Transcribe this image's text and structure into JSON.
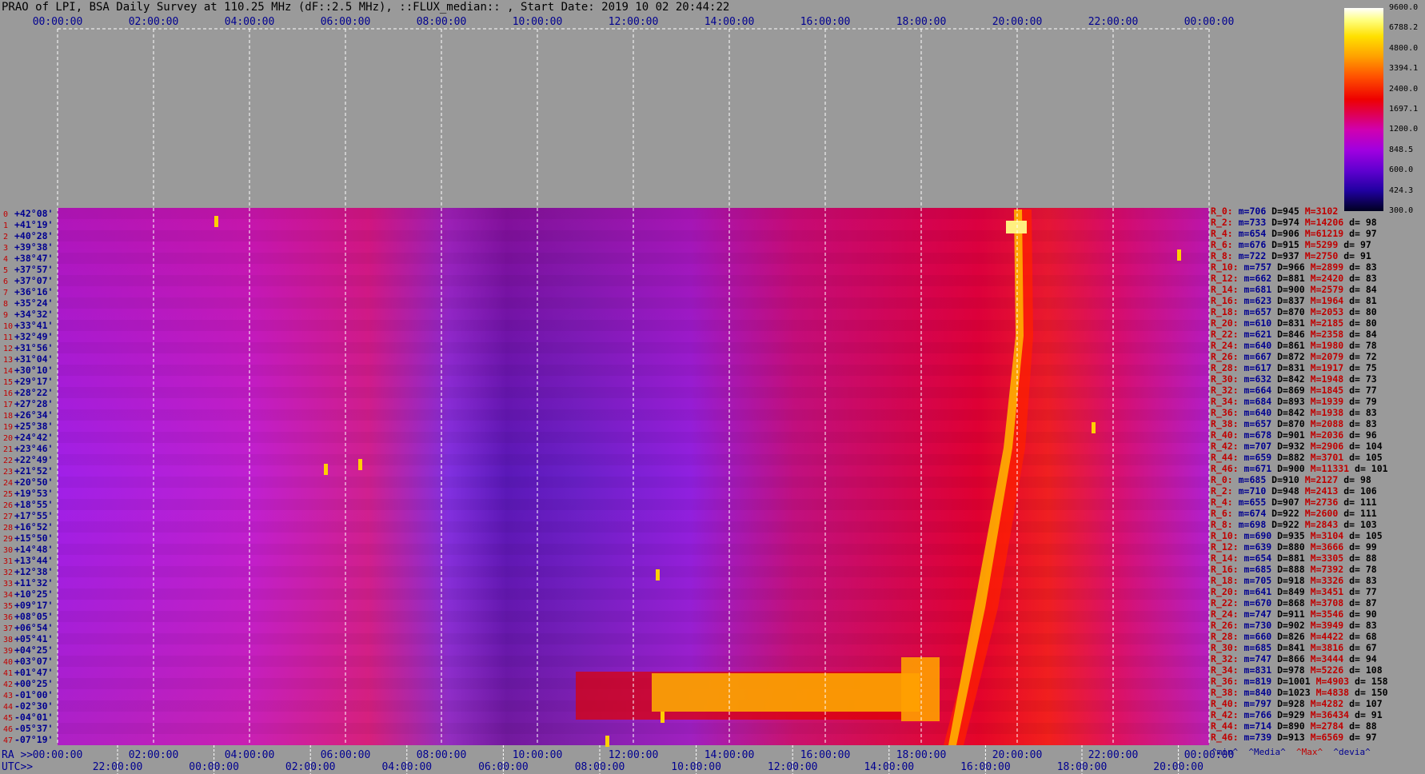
{
  "title": "PRAO of LPI, BSA Daily Survey at 110.25 MHz (dF::2.5 MHz), ::FLUX_median:: , Start Date: 2019 10 02 20:44:22",
  "colors": {
    "bg": "#9a9a9a",
    "label_red": "#c00000",
    "label_blue": "#000090"
  },
  "chart_data": {
    "type": "heatmap",
    "title": "PRAO of LPI, BSA Daily Survey at 110.25 MHz (dF::2.5 MHz), ::FLUX_median:: , Start Date: 2019 10 02 20:44:22",
    "top_axis_ticks": [
      "00:00:00",
      "02:00:00",
      "04:00:00",
      "06:00:00",
      "08:00:00",
      "10:00:00",
      "12:00:00",
      "14:00:00",
      "16:00:00",
      "18:00:00",
      "20:00:00",
      "22:00:00",
      "00:00:00"
    ],
    "ra_axis_ticks": [
      "00:00:00",
      "02:00:00",
      "04:00:00",
      "06:00:00",
      "08:00:00",
      "10:00:00",
      "12:00:00",
      "14:00:00",
      "16:00:00",
      "18:00:00",
      "20:00:00",
      "22:00:00",
      "00:00:00"
    ],
    "ra_axis_label": "RA >>",
    "utc_axis_ticks": [
      "22:00:00",
      "00:00:00",
      "02:00:00",
      "04:00:00",
      "06:00:00",
      "08:00:00",
      "10:00:00",
      "12:00:00",
      "14:00:00",
      "16:00:00",
      "18:00:00",
      "20:00:00"
    ],
    "utc_axis_label": "UTC>>",
    "declinations": [
      "+42°08'",
      "+41°19'",
      "+40°28'",
      "+39°38'",
      "+38°47'",
      "+37°57'",
      "+37°07'",
      "+36°16'",
      "+35°24'",
      "+34°32'",
      "+33°41'",
      "+32°49'",
      "+31°56'",
      "+31°04'",
      "+30°10'",
      "+29°17'",
      "+28°22'",
      "+27°28'",
      "+26°34'",
      "+25°38'",
      "+24°42'",
      "+23°46'",
      "+22°49'",
      "+21°52'",
      "+20°50'",
      "+19°53'",
      "+18°55'",
      "+17°55'",
      "+16°52'",
      "+15°50'",
      "+14°48'",
      "+13°44'",
      "+12°38'",
      "+11°32'",
      "+10°25'",
      "+09°17'",
      "+08°05'",
      "+06°54'",
      "+05°41'",
      "+04°25'",
      "+03°07'",
      "+01°47'",
      "+00°25'",
      "-01°00'",
      "-02°30'",
      "-04°01'",
      "-05°37'",
      "-07°19'"
    ],
    "colorbar_ticks": [
      "9600.0",
      "6788.2",
      "4800.0",
      "3394.1",
      "2400.0",
      "1697.1",
      "1200.0",
      "848.5",
      "600.0",
      "424.3",
      "300.0"
    ],
    "stats": [
      {
        "r": "R_0:",
        "m": "706",
        "d": "945",
        "h": "3102",
        "dev": ""
      },
      {
        "r": "R_2:",
        "m": "733",
        "d": "974",
        "h": "14206",
        "dev": "98"
      },
      {
        "r": "R_4:",
        "m": "654",
        "d": "906",
        "h": "61219",
        "dev": "97"
      },
      {
        "r": "R_6:",
        "m": "676",
        "d": "915",
        "h": "5299",
        "dev": "97"
      },
      {
        "r": "R_8:",
        "m": "722",
        "d": "937",
        "h": "2750",
        "dev": "91"
      },
      {
        "r": "R_10:",
        "m": "757",
        "d": "966",
        "h": "2899",
        "dev": "83"
      },
      {
        "r": "R_12:",
        "m": "662",
        "d": "881",
        "h": "2420",
        "dev": "83"
      },
      {
        "r": "R_14:",
        "m": "681",
        "d": "900",
        "h": "2579",
        "dev": "84"
      },
      {
        "r": "R_16:",
        "m": "623",
        "d": "837",
        "h": "1964",
        "dev": "81"
      },
      {
        "r": "R_18:",
        "m": "657",
        "d": "870",
        "h": "2053",
        "dev": "80"
      },
      {
        "r": "R_20:",
        "m": "610",
        "d": "831",
        "h": "2185",
        "dev": "80"
      },
      {
        "r": "R_22:",
        "m": "621",
        "d": "846",
        "h": "2358",
        "dev": "84"
      },
      {
        "r": "R_24:",
        "m": "640",
        "d": "861",
        "h": "1980",
        "dev": "78"
      },
      {
        "r": "R_26:",
        "m": "667",
        "d": "872",
        "h": "2079",
        "dev": "72"
      },
      {
        "r": "R_28:",
        "m": "617",
        "d": "831",
        "h": "1917",
        "dev": "75"
      },
      {
        "r": "R_30:",
        "m": "632",
        "d": "842",
        "h": "1948",
        "dev": "73"
      },
      {
        "r": "R_32:",
        "m": "664",
        "d": "869",
        "h": "1845",
        "dev": "77"
      },
      {
        "r": "R_34:",
        "m": "684",
        "d": "893",
        "h": "1939",
        "dev": "79"
      },
      {
        "r": "R_36:",
        "m": "640",
        "d": "842",
        "h": "1938",
        "dev": "83"
      },
      {
        "r": "R_38:",
        "m": "657",
        "d": "870",
        "h": "2088",
        "dev": "83"
      },
      {
        "r": "R_40:",
        "m": "678",
        "d": "901",
        "h": "2036",
        "dev": "96"
      },
      {
        "r": "R_42:",
        "m": "707",
        "d": "932",
        "h": "2906",
        "dev": "104"
      },
      {
        "r": "R_44:",
        "m": "659",
        "d": "882",
        "h": "3701",
        "dev": "105"
      },
      {
        "r": "R_46:",
        "m": "671",
        "d": "900",
        "h": "11331",
        "dev": "101"
      },
      {
        "r": "R_0:",
        "m": "685",
        "d": "910",
        "h": "2127",
        "dev": "98"
      },
      {
        "r": "R_2:",
        "m": "710",
        "d": "948",
        "h": "2413",
        "dev": "106"
      },
      {
        "r": "R_4:",
        "m": "655",
        "d": "907",
        "h": "2736",
        "dev": "111"
      },
      {
        "r": "R_6:",
        "m": "674",
        "d": "922",
        "h": "2600",
        "dev": "111"
      },
      {
        "r": "R_8:",
        "m": "698",
        "d": "922",
        "h": "2843",
        "dev": "103"
      },
      {
        "r": "R_10:",
        "m": "690",
        "d": "935",
        "h": "3104",
        "dev": "105"
      },
      {
        "r": "R_12:",
        "m": "639",
        "d": "880",
        "h": "3666",
        "dev": "99"
      },
      {
        "r": "R_14:",
        "m": "654",
        "d": "881",
        "h": "3305",
        "dev": "88"
      },
      {
        "r": "R_16:",
        "m": "685",
        "d": "888",
        "h": "7392",
        "dev": "78"
      },
      {
        "r": "R_18:",
        "m": "705",
        "d": "918",
        "h": "3326",
        "dev": "83"
      },
      {
        "r": "R_20:",
        "m": "641",
        "d": "849",
        "h": "3451",
        "dev": "77"
      },
      {
        "r": "R_22:",
        "m": "670",
        "d": "868",
        "h": "3708",
        "dev": "87"
      },
      {
        "r": "R_24:",
        "m": "747",
        "d": "911",
        "h": "3546",
        "dev": "90"
      },
      {
        "r": "R_26:",
        "m": "730",
        "d": "902",
        "h": "3949",
        "dev": "83"
      },
      {
        "r": "R_28:",
        "m": "660",
        "d": "826",
        "h": "4422",
        "dev": "68"
      },
      {
        "r": "R_30:",
        "m": "685",
        "d": "841",
        "h": "3816",
        "dev": "67"
      },
      {
        "r": "R_32:",
        "m": "747",
        "d": "866",
        "h": "3444",
        "dev": "94"
      },
      {
        "r": "R_34:",
        "m": "831",
        "d": "978",
        "h": "5226",
        "dev": "108"
      },
      {
        "r": "R_36:",
        "m": "819",
        "d": "1001",
        "h": "4903",
        "dev": "158"
      },
      {
        "r": "R_38:",
        "m": "840",
        "d": "1023",
        "h": "4838",
        "dev": "150"
      },
      {
        "r": "R_40:",
        "m": "797",
        "d": "928",
        "h": "4282",
        "dev": "107"
      },
      {
        "r": "R_42:",
        "m": "766",
        "d": "929",
        "h": "36434",
        "dev": "91"
      },
      {
        "r": "R_44:",
        "m": "714",
        "d": "890",
        "h": "2784",
        "dev": "88"
      },
      {
        "r": "R_46:",
        "m": "739",
        "d": "913",
        "h": "6569",
        "dev": "97"
      }
    ],
    "legend": [
      "^min^",
      "^Media^",
      "^Max^",
      "^devia^"
    ]
  }
}
